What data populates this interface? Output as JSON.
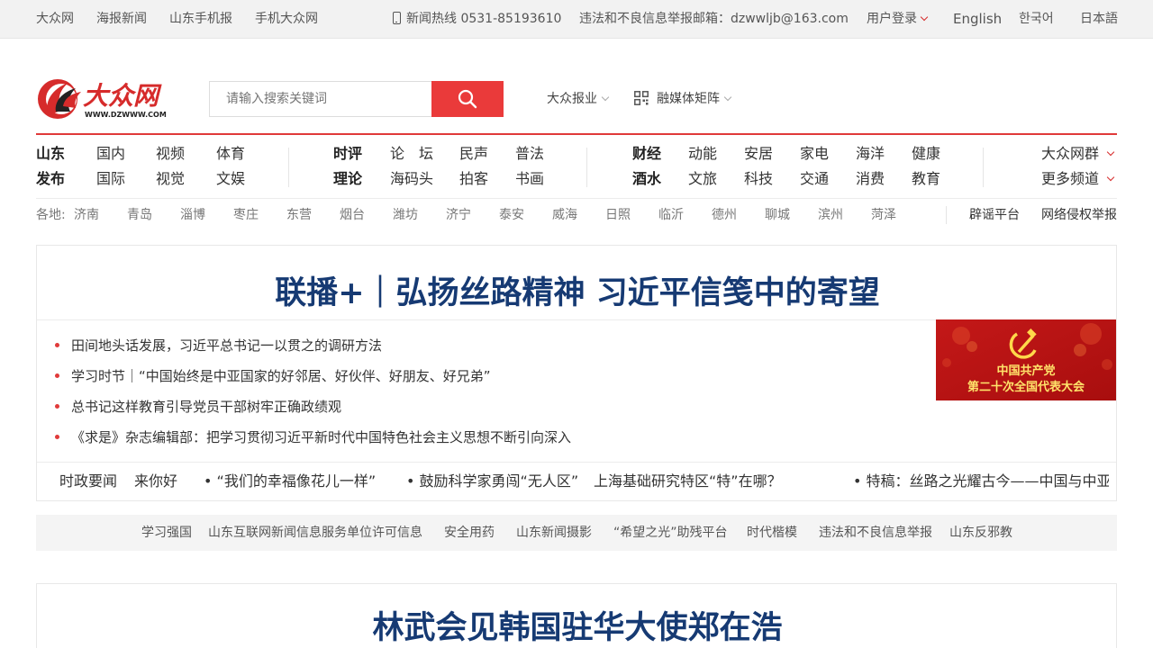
{
  "topbar": {
    "left_links": [
      "大众网",
      "海报新闻",
      "山东手机报",
      "手机大众网"
    ],
    "hotline": "新闻热线 0531-85193610",
    "report_email": "违法和不良信息举报邮箱：dzwwljb@163.com",
    "login": "用户登录",
    "languages": [
      "English",
      "한국어",
      "日本語"
    ]
  },
  "header": {
    "logo_text": "大众网",
    "logo_url_text": "WWW.DZWWW.COM",
    "search_placeholder": "请输入搜索关键词",
    "links": [
      "大众报业",
      "融媒体矩阵"
    ]
  },
  "nav": {
    "group1": {
      "labels": [
        "山东",
        "发布"
      ],
      "row1": [
        "国内",
        "视频",
        "体育"
      ],
      "row2": [
        "国际",
        "视觉",
        "文娱"
      ]
    },
    "group2": {
      "labels": [
        "时评",
        "理论"
      ],
      "row1": [
        "论　坛",
        "民声",
        "普法"
      ],
      "row2": [
        "海码头",
        "拍客",
        "书画"
      ]
    },
    "group3": {
      "labels": [
        "财经",
        "酒水"
      ],
      "row1": [
        "动能",
        "安居",
        "家电",
        "海洋",
        "健康"
      ],
      "row2": [
        "文旅",
        "科技",
        "交通",
        "消费",
        "教育"
      ]
    },
    "more": [
      "大众网群",
      "更多频道"
    ]
  },
  "regions": {
    "items": [
      "各地:",
      "济南",
      "青岛",
      "淄博",
      "枣庄",
      "东营",
      "烟台",
      "潍坊",
      "济宁",
      "泰安",
      "威海",
      "日照",
      "临沂",
      "德州",
      "聊城",
      "滨州",
      "菏泽"
    ],
    "right": [
      "辟谣平台",
      "网络侵权举报"
    ]
  },
  "main": {
    "headline": "联播+｜弘扬丝路精神 习近平信笺中的寄望",
    "bullets": [
      "田间地头话发展，习近平总书记一以贯之的调研方法",
      "学习时节｜“中国始终是中亚国家的好邻居、好伙伴、好朋友、好兄弟”",
      "总书记这样教育引导党员干部树牢正确政绩观",
      "《求是》杂志编辑部：把学习贯彻习近平新时代中国特色社会主义思想不断引向深入"
    ],
    "banner_lines": [
      "中国共产党",
      "第二十次全国代表大会"
    ],
    "ticker_label": "时政要闻",
    "ticker_items": [
      "来你好",
      "•  “我们的幸福像花儿一样”",
      "• 鼓励科学家勇闯“无人区”",
      "上海基础研究特区“特”在哪？",
      "• 特稿：丝路之光耀古今——中国与中亚国家"
    ]
  },
  "footer_links": [
    "学习强国",
    "山东互联网新闻信息服务单位许可信息",
    "安全用药",
    "山东新闻摄影",
    "“希望之光”助残平台",
    "时代楷模",
    "违法和不良信息举报",
    "山东反邪教"
  ],
  "headline2": "林武会见韩国驻华大使郑在浩",
  "colors": {
    "accent_red": "#e03a3a",
    "headline_blue": "#163a73"
  }
}
